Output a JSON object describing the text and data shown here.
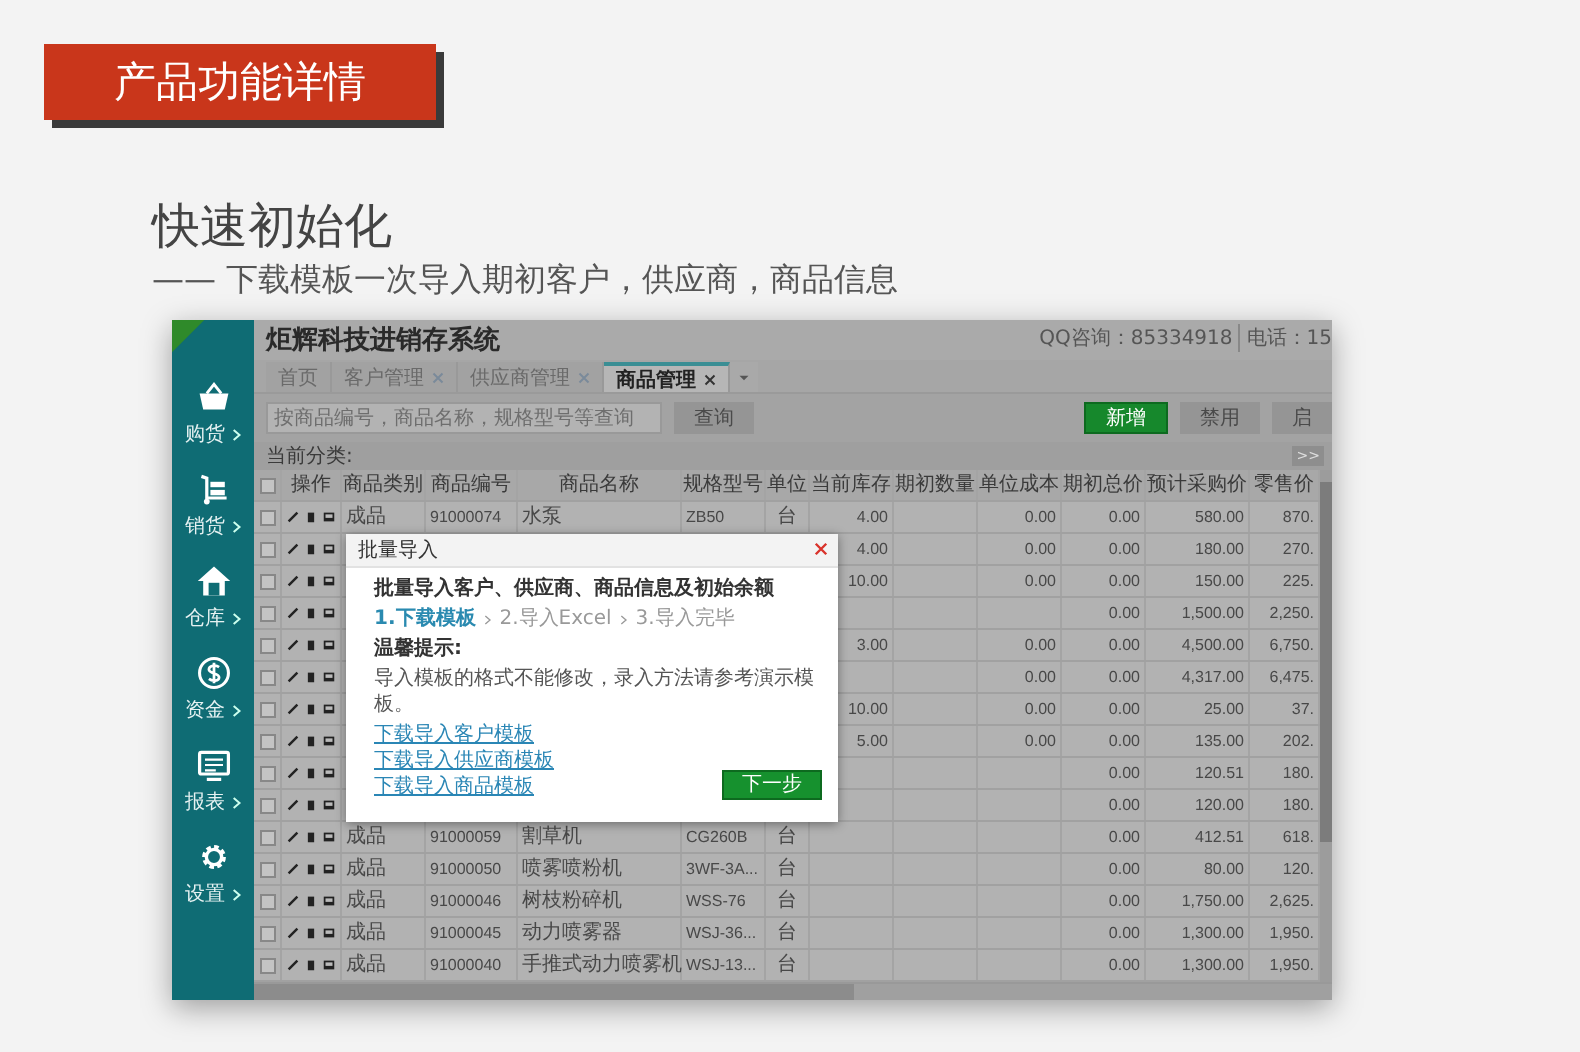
{
  "banner": {
    "title": "产品功能详情"
  },
  "heading": "快速初始化",
  "subheading": "—— 下载模板一次导入期初客户，供应商，商品信息",
  "app": {
    "title": "炬辉科技进销存系统",
    "contact": [
      "QQ咨询：85334918",
      "电话：15"
    ],
    "sidebar": [
      {
        "label": "购货"
      },
      {
        "label": "销货"
      },
      {
        "label": "仓库"
      },
      {
        "label": "资金"
      },
      {
        "label": "报表"
      },
      {
        "label": "设置"
      }
    ],
    "tabs": [
      {
        "label": "首页",
        "closable": false,
        "selected": false
      },
      {
        "label": "客户管理",
        "closable": true,
        "selected": false
      },
      {
        "label": "供应商管理",
        "closable": true,
        "selected": false
      },
      {
        "label": "商品管理",
        "closable": true,
        "selected": true
      }
    ],
    "search": {
      "placeholder": "按商品编号，商品名称，规格型号等查询",
      "button": "查询"
    },
    "actions": [
      {
        "label": "新增",
        "primary": true
      },
      {
        "label": "禁用",
        "primary": false
      },
      {
        "label": "启",
        "primary": false
      }
    ],
    "category_label": "当前分类:",
    "expand_button": ">>",
    "table": {
      "all_checked": false,
      "columns": [
        "操作",
        "商品类别",
        "商品编号",
        "商品名称",
        "规格型号",
        "单位",
        "当前库存",
        "期初数量",
        "单位成本",
        "期初总价",
        "预计采购价",
        "零售价"
      ],
      "rows": [
        {
          "checked": false,
          "category": "成品",
          "code": "91000074",
          "name": "水泵",
          "spec": "ZB50",
          "unit": "台",
          "stock": "4.00",
          "unit_cost": "0.00",
          "opening_total": "0.00",
          "purchase_price": "580.00",
          "retail_price": "870."
        },
        {
          "checked": false,
          "stock": "4.00",
          "unit_cost": "0.00",
          "opening_total": "0.00",
          "purchase_price": "180.00",
          "retail_price": "270."
        },
        {
          "checked": false,
          "stock": "10.00",
          "unit_cost": "0.00",
          "opening_total": "0.00",
          "purchase_price": "150.00",
          "retail_price": "225."
        },
        {
          "checked": false,
          "opening_total": "0.00",
          "purchase_price": "1,500.00",
          "retail_price": "2,250."
        },
        {
          "checked": false,
          "stock": "3.00",
          "unit_cost": "0.00",
          "opening_total": "0.00",
          "purchase_price": "4,500.00",
          "retail_price": "6,750."
        },
        {
          "checked": false,
          "unit_cost": "0.00",
          "opening_total": "0.00",
          "purchase_price": "4,317.00",
          "retail_price": "6,475."
        },
        {
          "checked": false,
          "stock": "10.00",
          "unit_cost": "0.00",
          "opening_total": "0.00",
          "purchase_price": "25.00",
          "retail_price": "37."
        },
        {
          "checked": false,
          "stock": "5.00",
          "unit_cost": "0.00",
          "opening_total": "0.00",
          "purchase_price": "135.00",
          "retail_price": "202."
        },
        {
          "checked": false,
          "opening_total": "0.00",
          "purchase_price": "120.51",
          "retail_price": "180."
        },
        {
          "checked": false,
          "opening_total": "0.00",
          "purchase_price": "120.00",
          "retail_price": "180."
        },
        {
          "checked": false,
          "category": "成品",
          "code": "91000059",
          "name": "割草机",
          "spec": "CG260B",
          "unit": "台",
          "opening_total": "0.00",
          "purchase_price": "412.51",
          "retail_price": "618."
        },
        {
          "checked": false,
          "category": "成品",
          "code": "91000050",
          "name": "喷雾喷粉机",
          "spec": "3WF-3A...",
          "unit": "台",
          "opening_total": "0.00",
          "purchase_price": "80.00",
          "retail_price": "120."
        },
        {
          "checked": false,
          "category": "成品",
          "code": "91000046",
          "name": "树枝粉碎机",
          "spec": "WSS-76",
          "unit": "台",
          "opening_total": "0.00",
          "purchase_price": "1,750.00",
          "retail_price": "2,625."
        },
        {
          "checked": false,
          "category": "成品",
          "code": "91000045",
          "name": "动力喷雾器",
          "spec": "WSJ-36...",
          "unit": "台",
          "opening_total": "0.00",
          "purchase_price": "1,300.00",
          "retail_price": "1,950."
        },
        {
          "checked": false,
          "category": "成品",
          "code": "91000040",
          "name": "手推式动力喷雾机",
          "spec": "WSJ-13...",
          "unit": "台",
          "opening_total": "0.00",
          "purchase_price": "1,300.00",
          "retail_price": "1,950."
        }
      ]
    },
    "dialog": {
      "title": "批量导入",
      "heading": "批量导入客户、供应商、商品信息及初始余额",
      "steps": [
        {
          "label": "1.下载模板",
          "selected": true
        },
        {
          "label": "2.导入Excel",
          "selected": false
        },
        {
          "label": "3.导入完毕",
          "selected": false
        }
      ],
      "tip_title": "温馨提示:",
      "tip": "导入模板的格式不能修改，录入方法请参考演示模板。",
      "links": [
        "下载导入客户模板",
        "下载导入供应商模板",
        "下载导入商品模板"
      ],
      "button": "下一步"
    }
  }
}
